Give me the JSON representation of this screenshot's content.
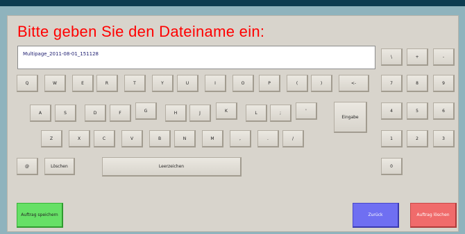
{
  "title": "Bitte geben Sie den Dateiname ein:",
  "input_value": "Multipage_2011-08-01_151128",
  "row1": [
    "Q",
    "W",
    "E",
    "R",
    "T",
    "Y",
    "U",
    "I",
    "O",
    "P",
    "(",
    ")"
  ],
  "backspace": "<-",
  "row2": [
    "A",
    "S",
    "D",
    "F",
    "G",
    "H",
    "J",
    "K",
    "L",
    ";",
    "'"
  ],
  "enter": "Eingabe",
  "row3": [
    "Z",
    "X",
    "C",
    "V",
    "B",
    "N",
    "M",
    ",",
    ".",
    "/"
  ],
  "at": "@",
  "clear": "Löschen",
  "space": "Leerzeichen",
  "numpad": {
    "ops": [
      "\\",
      "+",
      "-"
    ],
    "row1": [
      "7",
      "8",
      "9"
    ],
    "row2": [
      "4",
      "5",
      "6"
    ],
    "row3": [
      "1",
      "2",
      "3"
    ],
    "zero": "0"
  },
  "buttons": {
    "save": "Auftrag speichern",
    "back": "Zurück",
    "delete": "Auftrag löschen"
  },
  "colors": {
    "title": "#ff0000",
    "save": "#66e066",
    "back": "#6f6ff2",
    "delete": "#f06b6b"
  }
}
